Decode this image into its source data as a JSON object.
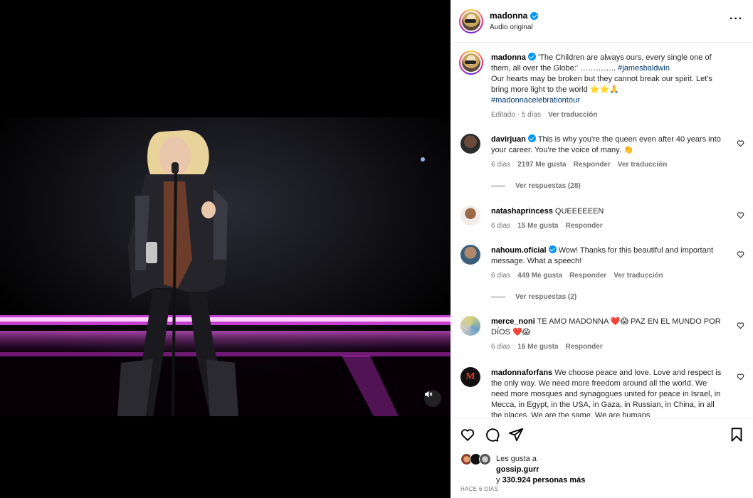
{
  "header": {
    "username": "madonna",
    "audio": "Audio original"
  },
  "caption": {
    "username": "madonna",
    "text": "'The Children are always ours, every single one of them, all over the Globe:' ………….. ",
    "hashtag1": "#jamesbaldwin",
    "line2": "Our hearts may be broken but they cannot break our spirit. Let's bring more light to the world ⭐⭐🙏",
    "hashtag2": "#madonnacelebrationtour",
    "edited": "Editado · 5 días",
    "translate": "Ver traducción"
  },
  "comments": [
    {
      "username": "davirjuan",
      "verified": true,
      "text": "This is why you're the queen even after 40 years into your career. You're the voice of many. 👏",
      "time": "6 días",
      "likes": "2197 Me gusta",
      "reply": "Responder",
      "translate": "Ver traducción",
      "replies": "Ver respuestas (28)"
    },
    {
      "username": "natashaprincess",
      "verified": false,
      "text": "QUEEEEEEN",
      "time": "6 días",
      "likes": "15 Me gusta",
      "reply": "Responder"
    },
    {
      "username": "nahoum.oficial",
      "verified": true,
      "text": "Wow! Thanks for this beautiful and important message. What a speech!",
      "time": "6 días",
      "likes": "449 Me gusta",
      "reply": "Responder",
      "translate": "Ver traducción",
      "replies": "Ver respuestas (2)"
    },
    {
      "username": "merce_noni",
      "verified": false,
      "text": "TE AMO MADONNA ❤️😱 PAZ EN EL MUNDO POR DÍOS ❤️😱",
      "time": "6 días",
      "likes": "16 Me gusta",
      "reply": "Responder"
    },
    {
      "username": "madonnaforfans",
      "verified": false,
      "text": "We choose peace and love. Love and respect is the only way. We need more freedom around all the world. We need more mosques and synagogues united for peace in Israel, in Mecca, in Egypt, in the USA, in Gaza, in Russian, in China, in all the places. We are the same. We are humans."
    }
  ],
  "likes": {
    "prefix": "Les gusta a",
    "user": "gossip.gurr",
    "suffix_pre": "y ",
    "count": "330.924 personas más"
  },
  "posted": "HACE 6 DÍAS",
  "icons": {
    "more": "more-options-icon",
    "mute": "muted-audio-icon",
    "like": "heart-icon",
    "comment": "comment-icon",
    "share": "paper-plane-icon",
    "save": "bookmark-icon"
  },
  "colors": {
    "verified": "#0095f6",
    "link": "#00376b",
    "muted_text": "#737373",
    "heart_red": "#e0245e",
    "stage_pink": "#ff3df5"
  }
}
